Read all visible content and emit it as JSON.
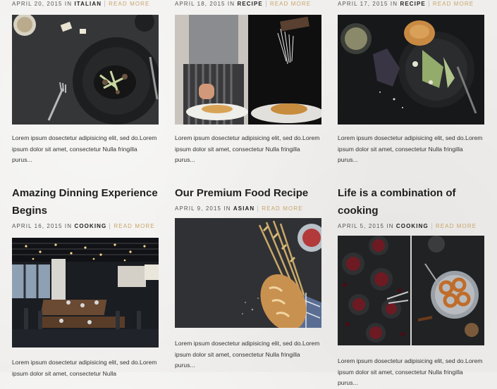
{
  "posts": [
    {
      "date": "APRIL 20, 2015",
      "in": "IN",
      "category": "ITALIAN",
      "more": "READ MORE",
      "excerpt": "Lorem ipsum dosectetur adipisicing elit, sed do.Lorem ipsum dolor sit amet, consectetur Nulla fringilla purus..."
    },
    {
      "date": "APRIL 18, 2015",
      "in": "IN",
      "category": "RECIPE",
      "more": "READ MORE",
      "excerpt": "Lorem ipsum dosectetur adipisicing elit, sed do.Lorem ipsum dolor sit amet, consectetur Nulla fringilla purus..."
    },
    {
      "date": "APRIL 17, 2015",
      "in": "IN",
      "category": "RECIPE",
      "more": "READ MORE",
      "excerpt": "Lorem ipsum dosectetur adipisicing elit, sed do.Lorem ipsum dolor sit amet, consectetur Nulla fringilla purus..."
    },
    {
      "title": "Amazing Dinning Experience Begins",
      "date": "APRIL 16, 2015",
      "in": "IN",
      "category": "COOKING",
      "more": "READ MORE",
      "excerpt": "Lorem ipsum dosectetur adipisicing elit, sed do.Lorem ipsum dolor sit amet, consectetur Nulla"
    },
    {
      "title": "Our Premium Food Recipe",
      "date": "APRIL 9, 2015",
      "in": "IN",
      "category": "ASIAN",
      "more": "READ MORE",
      "excerpt": "Lorem ipsum dosectetur adipisicing elit, sed do.Lorem ipsum dolor sit amet, consectetur Nulla fringilla purus..."
    },
    {
      "title": "Life is a combination of cooking",
      "date": "APRIL 5, 2015",
      "in": "IN",
      "category": "COOKING",
      "more": "READ MORE",
      "excerpt": "Lorem ipsum dosectetur adipisicing elit, sed do.Lorem ipsum dolor sit amet, consectetur Nulla fringilla purus..."
    }
  ]
}
